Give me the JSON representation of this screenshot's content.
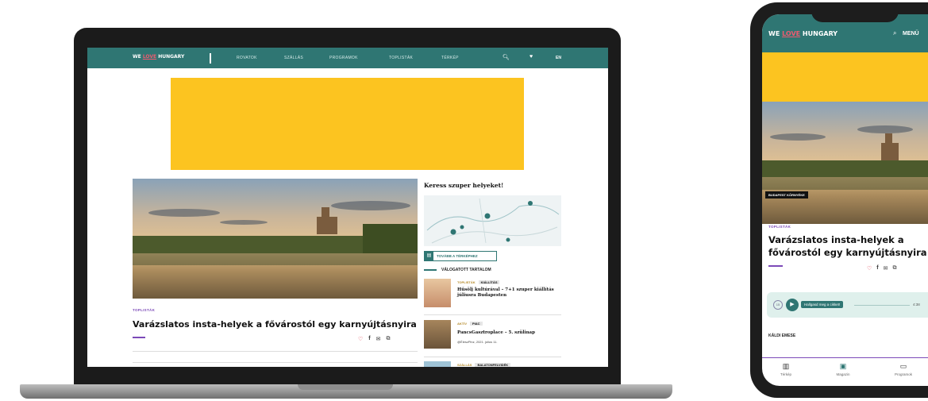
{
  "brand": {
    "logo_we": "WE ",
    "logo_love": "LOVE",
    "logo_hungary": " HUNGARY"
  },
  "desktop": {
    "nav": {
      "links": [
        "ROVATOK",
        "SZÁLLÁS",
        "PROGRAMOK",
        "TOPLISTÁK",
        "TÉRKÉP"
      ],
      "language": "EN",
      "icons": [
        "search-icon",
        "heart-icon"
      ]
    },
    "article": {
      "kicker": "TOPLISTÁK",
      "title": "Varázslatos insta-helyek a fővárostól egy karnyújtásnyira",
      "share_icons": [
        "heart-icon",
        "facebook-icon",
        "mail-icon",
        "copy-icon"
      ]
    },
    "sidebar": {
      "title": "Keress szuper helyeket!",
      "map_button": "TOVÁBB A TÉRKÉPHEZ",
      "section_title": "VÁLOGATOTT TARTALOM",
      "cards": [
        {
          "tag1": "TOPLISTÁK",
          "tag2": "KIÁLLÍTÁS",
          "title": "Hűsölj kultúrával – 7+1 szuper kiállítás júliusra Budapesten",
          "meta": ""
        },
        {
          "tag1": "AKTÍV",
          "tag2": "PIAC",
          "title": "PancsGasztroplace – 5. szülinap",
          "meta": "@ÉleszPinz, 2021. július 11."
        },
        {
          "tag1": "SZÁLLÁS",
          "tag2": "BALATONFELVIDÉK",
          "title": "",
          "meta": ""
        }
      ]
    }
  },
  "mobile": {
    "nav": {
      "menu_label": "MENÜ"
    },
    "hero_badge": "BUDAPEST KÖRNYÉKE",
    "article": {
      "kicker": "TOPLISTÁK",
      "title": "Varázslatos insta-helyek a fővárostól egy karnyújtásnyira"
    },
    "player": {
      "rewind_label": "15",
      "listen_label": "Hallgasd meg a cikket!",
      "duration": "4:38"
    },
    "author": "KÁLDI EMESE",
    "tabbar": [
      {
        "label": "Térkép",
        "icon": "map-icon"
      },
      {
        "label": "Magazin",
        "icon": "magazine-icon"
      },
      {
        "label": "Programok",
        "icon": "calendar-icon"
      }
    ]
  },
  "colors": {
    "brand_teal": "#2f7673",
    "ad_yellow": "#fcc420",
    "accent_purple": "#7c4ab8",
    "love_pink": "#ee5a6f"
  }
}
